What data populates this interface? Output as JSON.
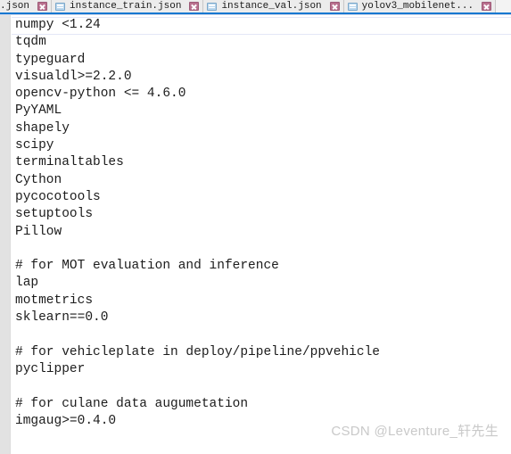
{
  "window": {
    "app_kind": "text-editor",
    "accent_color": "#1678d0",
    "gutter_color": "#e2e2e2"
  },
  "tabbar": {
    "tabs": [
      {
        "label": ".json",
        "truncated_left": true,
        "file_icon": "file-json-icon",
        "close_icon": "close-icon",
        "active": false
      },
      {
        "label": "instance_train.json",
        "truncated_left": false,
        "file_icon": "file-json-icon",
        "close_icon": "close-icon",
        "active": false
      },
      {
        "label": "instance_val.json",
        "truncated_left": false,
        "file_icon": "file-json-icon",
        "close_icon": "close-icon",
        "active": false
      },
      {
        "label": "yolov3_mobilenet...",
        "truncated_left": false,
        "file_icon": "file-yaml-icon",
        "close_icon": "close-icon",
        "active": true
      }
    ]
  },
  "editor": {
    "lines": [
      "numpy <1.24",
      "tqdm",
      "typeguard",
      "visualdl>=2.2.0",
      "opencv-python <= 4.6.0",
      "PyYAML",
      "shapely",
      "scipy",
      "terminaltables",
      "Cython",
      "pycocotools",
      "setuptools",
      "Pillow",
      "",
      "# for MOT evaluation and inference",
      "lap",
      "motmetrics",
      "sklearn==0.0",
      "",
      "# for vehicleplate in deploy/pipeline/ppvehicle",
      "pyclipper",
      "",
      "# for culane data augumetation",
      "imgaug>=0.4.0"
    ],
    "current_line_index": 0
  },
  "watermark": {
    "text": "CSDN @Leventure_轩先生"
  }
}
